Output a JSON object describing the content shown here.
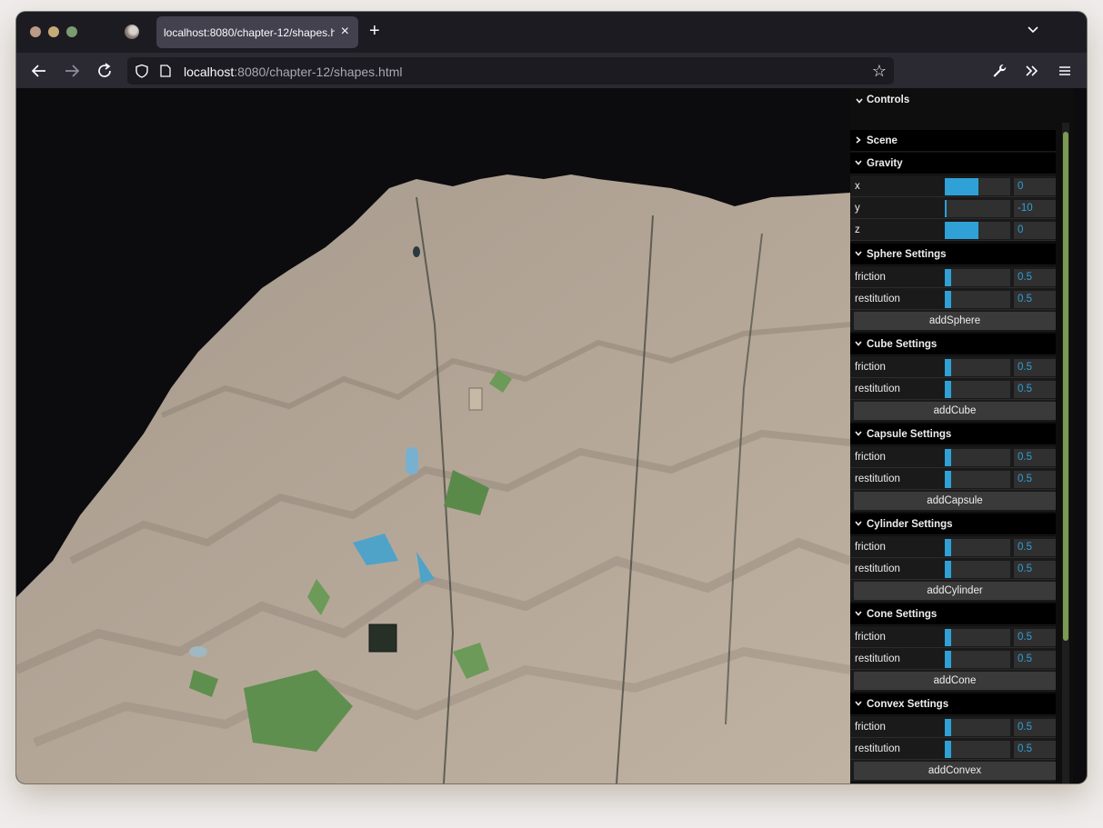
{
  "browser": {
    "tab_title": "localhost:8080/chapter-12/shapes.h",
    "tab_title_fade": "tml",
    "tab_close": "×",
    "new_tab": "+",
    "url_host": "localhost",
    "url_path": ":8080/chapter-12/shapes.html"
  },
  "gui": {
    "title": "Controls",
    "scene_label": "Scene",
    "gravity": {
      "label": "Gravity",
      "x_label": "x",
      "x_value": "0",
      "x_fraction": 0.5,
      "y_label": "y",
      "y_value": "-10",
      "y_fraction": 0.0,
      "z_label": "z",
      "z_value": "0",
      "z_fraction": 0.5
    },
    "sections": [
      {
        "label": "Sphere Settings",
        "friction_label": "friction",
        "friction": "0.5",
        "restitution_label": "restitution",
        "restitution": "0.5",
        "button": "addSphere"
      },
      {
        "label": "Cube Settings",
        "friction_label": "friction",
        "friction": "0.5",
        "restitution_label": "restitution",
        "restitution": "0.5",
        "button": "addCube"
      },
      {
        "label": "Capsule Settings",
        "friction_label": "friction",
        "friction": "0.5",
        "restitution_label": "restitution",
        "restitution": "0.5",
        "button": "addCapsule"
      },
      {
        "label": "Cylinder Settings",
        "friction_label": "friction",
        "friction": "0.5",
        "restitution_label": "restitution",
        "restitution": "0.5",
        "button": "addCylinder"
      },
      {
        "label": "Cone Settings",
        "friction_label": "friction",
        "friction": "0.5",
        "restitution_label": "restitution",
        "restitution": "0.5",
        "button": "addCone"
      },
      {
        "label": "Convex Settings",
        "friction_label": "friction",
        "friction": "0.5",
        "restitution_label": "restitution",
        "restitution": "0.5",
        "button": "addConvex"
      }
    ],
    "slider_fraction_friction": 0.08,
    "accent_color": "#2fa1d6"
  },
  "icons": [
    "back-arrow-icon",
    "forward-arrow-icon",
    "reload-icon",
    "shield-icon",
    "page-icon",
    "bookmark-star-icon",
    "wrench-icon",
    "overflow-chevron-icon",
    "hamburger-menu-icon",
    "tab-list-chevron-icon",
    "firefox-icon"
  ]
}
